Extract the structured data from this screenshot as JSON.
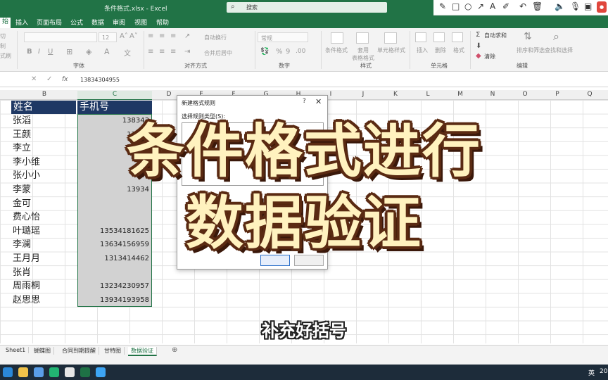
{
  "window": {
    "filename": "条件格式.xlsx  -  Excel",
    "search_placeholder": "搜索"
  },
  "tabs": [
    "始",
    "插入",
    "页面布局",
    "公式",
    "数据",
    "审阅",
    "视图",
    "帮助"
  ],
  "ribbon": {
    "groups": [
      "字体",
      "对齐方式",
      "数字",
      "样式",
      "单元格",
      "编辑"
    ],
    "labels": {
      "autowrap": "自动换行",
      "merge": "合并后居中",
      "numfmt": "常规",
      "cond": "条件格式",
      "table": "套用\n表格格式",
      "cellstyle": "单元格样式",
      "insert": "插入",
      "delete": "删除",
      "format": "格式",
      "autosum": "自动求和",
      "clear": "清除",
      "sort": "排序和筛选",
      "find": "查找和选择",
      "fontsize": "12",
      "clipboard_cut": "切",
      "clipboard_copy": "制",
      "clipboard_format": "式刷"
    }
  },
  "formula_bar": {
    "cancel": "✕",
    "confirm": "✓",
    "fx": "fx",
    "value": "13834304955"
  },
  "columns": [
    "B",
    "C",
    "D",
    "E",
    "F",
    "G",
    "H",
    "I",
    "J",
    "K",
    "L",
    "M",
    "N",
    "O",
    "P",
    "Q"
  ],
  "table": {
    "name_header": "姓名",
    "phone_header": "手机号",
    "names": [
      "张滔",
      "王颜",
      "李立",
      "李小维",
      "张小小",
      "李蒙",
      "金可",
      "费心怡",
      "叶璐瑶",
      "李澜",
      "王月月",
      "张肖",
      "周雨桐",
      "赵思思"
    ],
    "phones": [
      "138343",
      "13733",
      "13734",
      "132",
      "135",
      "13934",
      "",
      "",
      "13534181625",
      "13634156959",
      "1313414462",
      "",
      "13234230957",
      "13934193958"
    ]
  },
  "dialog": {
    "title": "新建格式规则",
    "help": "?",
    "close": "✕",
    "rule_type_label": "选择规则类型(S):"
  },
  "overlay": {
    "line1": "条件格式进行",
    "line2": "数据验证"
  },
  "subtitle": "补充好括号",
  "sheet_tabs": [
    "Sheet1",
    "蝴蝶图",
    "合同到期提醒",
    "甘特图",
    "数据验证"
  ],
  "active_sheet_index": 4,
  "tray": {
    "lang": "英",
    "time": "20"
  },
  "colors": {
    "excel_green": "#217346",
    "header_navy": "#1f3864",
    "selection_gray": "#d2d2d2",
    "overlay_fill": "#fff2bf",
    "overlay_outline": "#5a2a12"
  }
}
